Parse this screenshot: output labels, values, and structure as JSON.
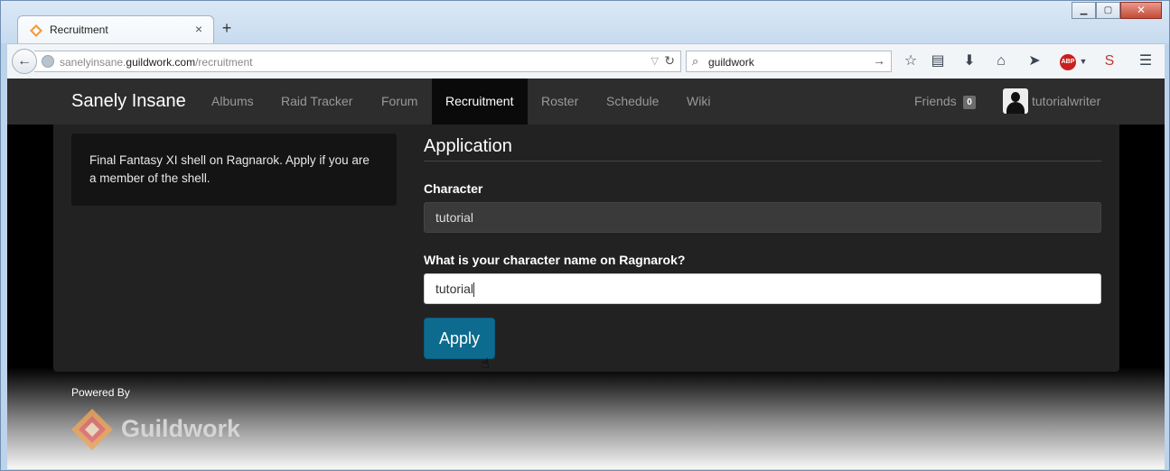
{
  "browser": {
    "tab_title": "Recruitment",
    "tab_close": "×",
    "new_tab": "+",
    "url_prefix": "sanelyinsane.",
    "url_domain": "guildwork.com",
    "url_path": "/recruitment",
    "search_value": "guildwork",
    "window_controls": {
      "minimize": "▭",
      "maximize": "□",
      "close": "✕"
    },
    "abp_label": "ABP"
  },
  "site": {
    "brand": "Sanely Insane",
    "nav": [
      "Albums",
      "Raid Tracker",
      "Forum",
      "Recruitment",
      "Roster",
      "Schedule",
      "Wiki"
    ],
    "active_nav": "Recruitment",
    "friends_label": "Friends",
    "friends_count": "0",
    "username": "tutorialwriter"
  },
  "blurb": "Final Fantasy XI shell on Ragnarok. Apply if you are a member of the shell.",
  "form": {
    "title": "Application",
    "character_label": "Character",
    "character_value": "tutorial",
    "question_label": "What is your character name on Ragnarok?",
    "question_value": "tutorial",
    "apply_label": "Apply"
  },
  "footer": {
    "powered_by": "Powered By",
    "brand": "Guildwork"
  },
  "colors": {
    "site_nav_bg": "#2d2d2d",
    "content_bg": "#222222",
    "apply_btn": "#0d6b8f"
  }
}
